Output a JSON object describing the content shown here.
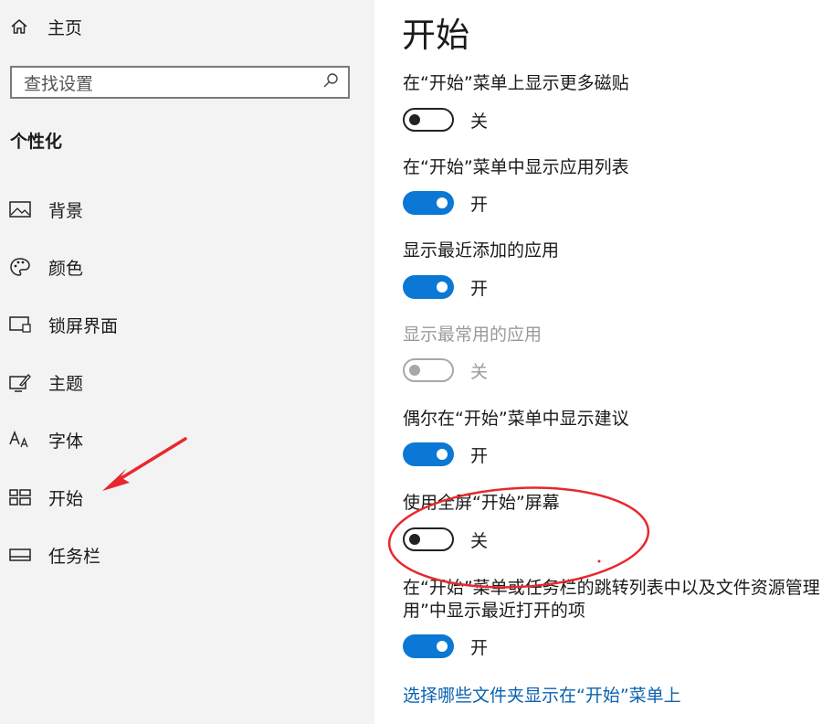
{
  "sidebar": {
    "home_label": "主页",
    "search_placeholder": "查找设置",
    "section_title": "个性化",
    "items": [
      {
        "label": "背景",
        "icon": "image-icon"
      },
      {
        "label": "颜色",
        "icon": "palette-icon"
      },
      {
        "label": "锁屏界面",
        "icon": "lock-screen-icon"
      },
      {
        "label": "主题",
        "icon": "theme-icon"
      },
      {
        "label": "字体",
        "icon": "font-icon"
      },
      {
        "label": "开始",
        "icon": "start-icon"
      },
      {
        "label": "任务栏",
        "icon": "taskbar-icon"
      }
    ]
  },
  "main": {
    "title": "开始",
    "settings": [
      {
        "label": "在“开始”菜单上显示更多磁贴",
        "state": "关",
        "on": false,
        "disabled": false
      },
      {
        "label": "在“开始”菜单中显示应用列表",
        "state": "开",
        "on": true,
        "disabled": false
      },
      {
        "label": "显示最近添加的应用",
        "state": "开",
        "on": true,
        "disabled": false
      },
      {
        "label": "显示最常用的应用",
        "state": "关",
        "on": false,
        "disabled": true
      },
      {
        "label": "偶尔在“开始”菜单中显示建议",
        "state": "开",
        "on": true,
        "disabled": false
      },
      {
        "label": "使用全屏“开始”屏幕",
        "state": "关",
        "on": false,
        "disabled": false
      },
      {
        "label_line1": "在“开始”菜单或任务栏的跳转列表中以及文件资源管理",
        "label_line2": "用”中显示最近打开的项",
        "state": "开",
        "on": true,
        "disabled": false
      }
    ],
    "link": "选择哪些文件夹显示在“开始”菜单上"
  },
  "colors": {
    "accent": "#0a78d4",
    "annotation": "#e8282e",
    "link": "#0a62b0"
  }
}
